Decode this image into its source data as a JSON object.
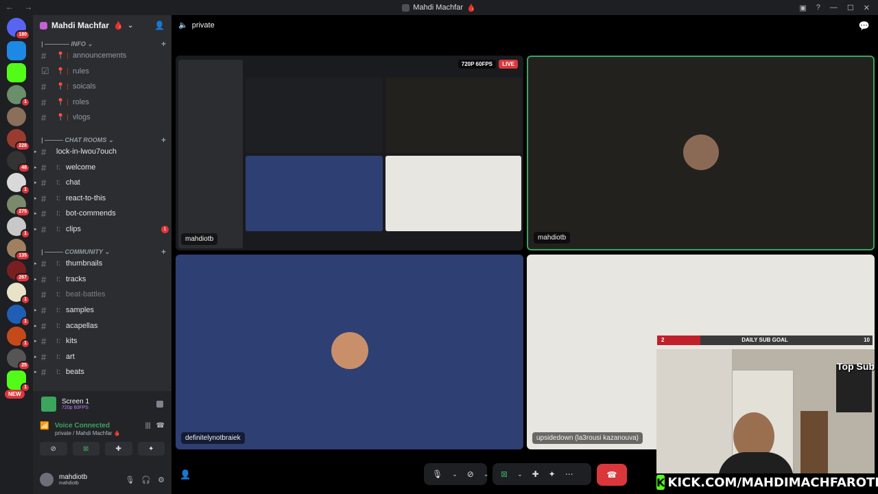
{
  "window": {
    "title": "Mahdi Machfar",
    "flame": "🩸",
    "nav": "← →",
    "controls": [
      "▣",
      "?",
      "—",
      "☐",
      "✕"
    ]
  },
  "guilds": {
    "home_badge": "180",
    "badges": [
      "1",
      "228",
      "48",
      "1",
      "275",
      "1",
      "135",
      "267",
      "1",
      "1",
      "1",
      "1",
      "25",
      "1"
    ],
    "new_label": "NEW"
  },
  "server": {
    "name": "Mahdi Machfar",
    "flame": "🩸"
  },
  "categories": [
    {
      "label": "| ———— INFO ⌄"
    },
    {
      "label": "| ——— CHAT ROOMS ⌄"
    },
    {
      "label": "| ——— COMMUNITY ⌄"
    }
  ],
  "channels": [
    {
      "prefix": "📍 |",
      "name": "announcements"
    },
    {
      "prefix": "📍 |",
      "name": "rules"
    },
    {
      "prefix": "📍 |",
      "name": "soicals"
    },
    {
      "prefix": "📍 |",
      "name": "roles"
    },
    {
      "prefix": "📍 |",
      "name": "vlogs"
    },
    {
      "prefix": "",
      "name": "lock-in-lwou7ouch"
    },
    {
      "prefix": "⁝:",
      "name": "welcome"
    },
    {
      "prefix": "⁝:",
      "name": "chat"
    },
    {
      "prefix": "⁝:",
      "name": "react-to-this"
    },
    {
      "prefix": "⁝:",
      "name": "bot-commends"
    },
    {
      "prefix": "⁝:",
      "name": "clips",
      "unread": "1"
    },
    {
      "prefix": "⁝:",
      "name": "thumbnails"
    },
    {
      "prefix": "⁝:",
      "name": "tracks"
    },
    {
      "prefix": "⁝:",
      "name": "beat-battles"
    },
    {
      "prefix": "⁝:",
      "name": "samples"
    },
    {
      "prefix": "⁝:",
      "name": "acapellas"
    },
    {
      "prefix": "⁝:",
      "name": "kits"
    },
    {
      "prefix": "⁝:",
      "name": "art"
    },
    {
      "prefix": "⁝:",
      "name": "beats"
    }
  ],
  "screen_panel": {
    "title": "Screen 1",
    "quality": "720p 60FPS"
  },
  "voice_panel": {
    "status": "Voice Connected",
    "location": "private / Mahdi Machfar 🩸"
  },
  "user_panel": {
    "name": "mahdiotb",
    "tag": "mahdiotb"
  },
  "call": {
    "channel_name": "private",
    "stream_quality": "720P 60FPS",
    "live_label": "LIVE",
    "tiles": {
      "stream_user": "mahdiotb",
      "cam_user": "mahdiotb",
      "user3": "definitelynotbraiek",
      "user4": "upsidedown (la3rousi kazanouva)"
    }
  },
  "overlay": {
    "sub_goal_current": "2",
    "sub_goal_label": "DAILY SUB GOAL",
    "sub_goal_target": "10",
    "sub_goal_progress": 0.2,
    "top_sub": "Top Sub",
    "kick_url": "KICK.COM/MAHDIMACHFAROTB"
  },
  "colors": {
    "accent_green": "#3ba55d",
    "danger": "#da373c",
    "kick_green": "#53fc18",
    "tile_blue": "#2e3f73"
  }
}
